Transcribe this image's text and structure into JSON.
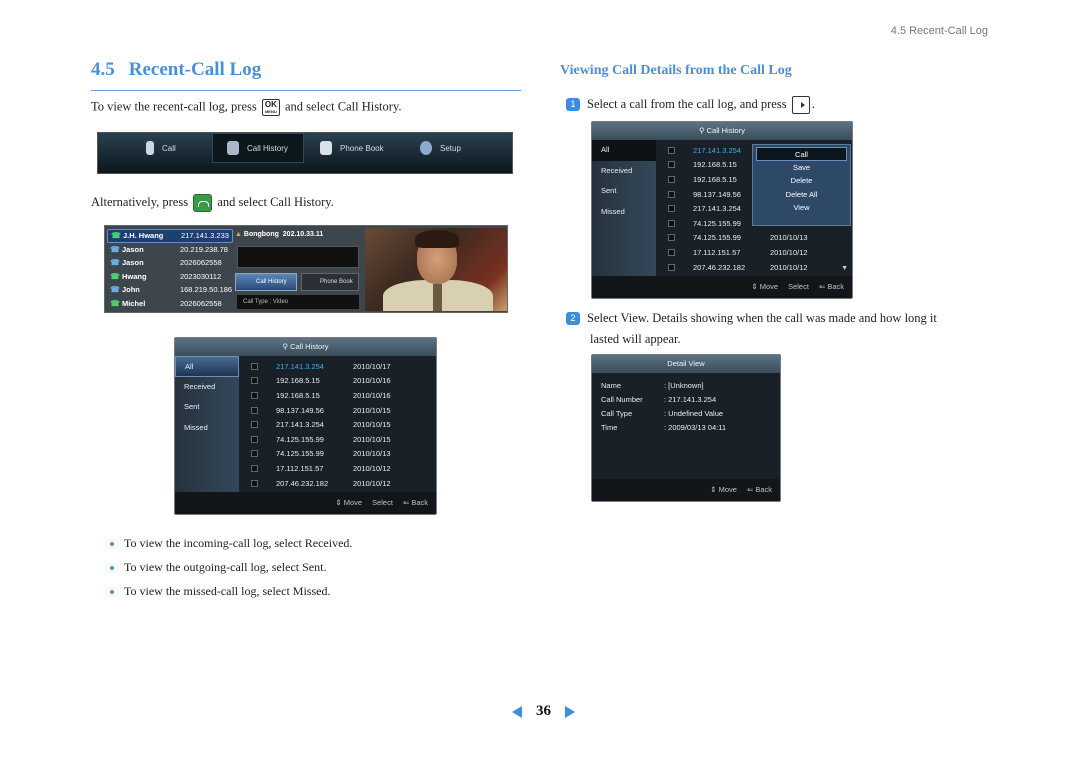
{
  "running_head": "4.5 Recent-Call Log",
  "section": {
    "number": "4.5",
    "title": "Recent-Call Log"
  },
  "intro": {
    "before": "To view the recent-call log, press",
    "key_top": "OK",
    "key_bottom": "MENU",
    "after": "and select Call History."
  },
  "menubar": {
    "items": [
      {
        "label": "Call",
        "icon": "phone-icon"
      },
      {
        "label": "Call History",
        "icon": "call-history-icon",
        "selected": true
      },
      {
        "label": "Phone Book",
        "icon": "phone-book-icon"
      },
      {
        "label": "Setup",
        "icon": "gear-icon"
      }
    ]
  },
  "alt": {
    "before": "Alternatively, press",
    "after": "and select Call History."
  },
  "phone_screen": {
    "contacts": [
      {
        "name": "J.H. Hwang",
        "number": "217.141.3.233",
        "selected": true
      },
      {
        "name": "Jason",
        "number": "20.219.238.78"
      },
      {
        "name": "Jason",
        "number": "2026062558"
      },
      {
        "name": "Hwang",
        "number": "2023030112"
      },
      {
        "name": "John",
        "number": "168.219.50.186"
      },
      {
        "name": "Michel",
        "number": "2026062558"
      }
    ],
    "caller": "Bongbong",
    "caller_ip": "202.10.33.11",
    "btn_call_history": "Call History",
    "btn_phone_book": "Phone Book",
    "call_type": "Call Type : Video"
  },
  "call_history": {
    "title": "Call History",
    "tabs": [
      "All",
      "Received",
      "Sent",
      "Missed"
    ],
    "rows": [
      {
        "ip": "217.141.3.254",
        "date": "2010/10/17"
      },
      {
        "ip": "192.168.5.15",
        "date": "2010/10/16"
      },
      {
        "ip": "192.168.5.15",
        "date": "2010/10/16"
      },
      {
        "ip": "98.137.149.56",
        "date": "2010/10/15"
      },
      {
        "ip": "217.141.3.254",
        "date": "2010/10/15"
      },
      {
        "ip": "74.125.155.99",
        "date": "2010/10/15"
      },
      {
        "ip": "74.125.155.99",
        "date": "2010/10/13"
      },
      {
        "ip": "17.112.151.57",
        "date": "2010/10/12"
      },
      {
        "ip": "207.46.232.182",
        "date": "2010/10/12"
      }
    ],
    "footer": {
      "move": "⇕ Move",
      "select": "Select",
      "back": "⇐ Back"
    }
  },
  "bullets": [
    "To view the incoming-call log, select Received.",
    "To view the outgoing-call log, select Sent.",
    "To view the missed-call log, select Missed."
  ],
  "subsection": {
    "title": "Viewing Call Details from the Call Log"
  },
  "step1": {
    "num": "1",
    "text": "Select a call from the call log, and press"
  },
  "popup_menu": [
    "Call",
    "Save",
    "Delete",
    "Delete All",
    "View"
  ],
  "step2": {
    "num": "2",
    "line1": "Select View.  Details showing when the call was made and how long it",
    "line2": "lasted will appear."
  },
  "detail_view": {
    "title": "Detail View",
    "fields": [
      {
        "label": "Name",
        "value": ": [Unknown]"
      },
      {
        "label": "Call Number",
        "value": ": 217.141.3.254"
      },
      {
        "label": "Call Type",
        "value": ": Undefined Value"
      },
      {
        "label": "Time",
        "value": ": 2009/03/13 04:11"
      }
    ],
    "footer": {
      "move": "⇕ Move",
      "back": "⇐ Back"
    }
  },
  "page_number": "36"
}
